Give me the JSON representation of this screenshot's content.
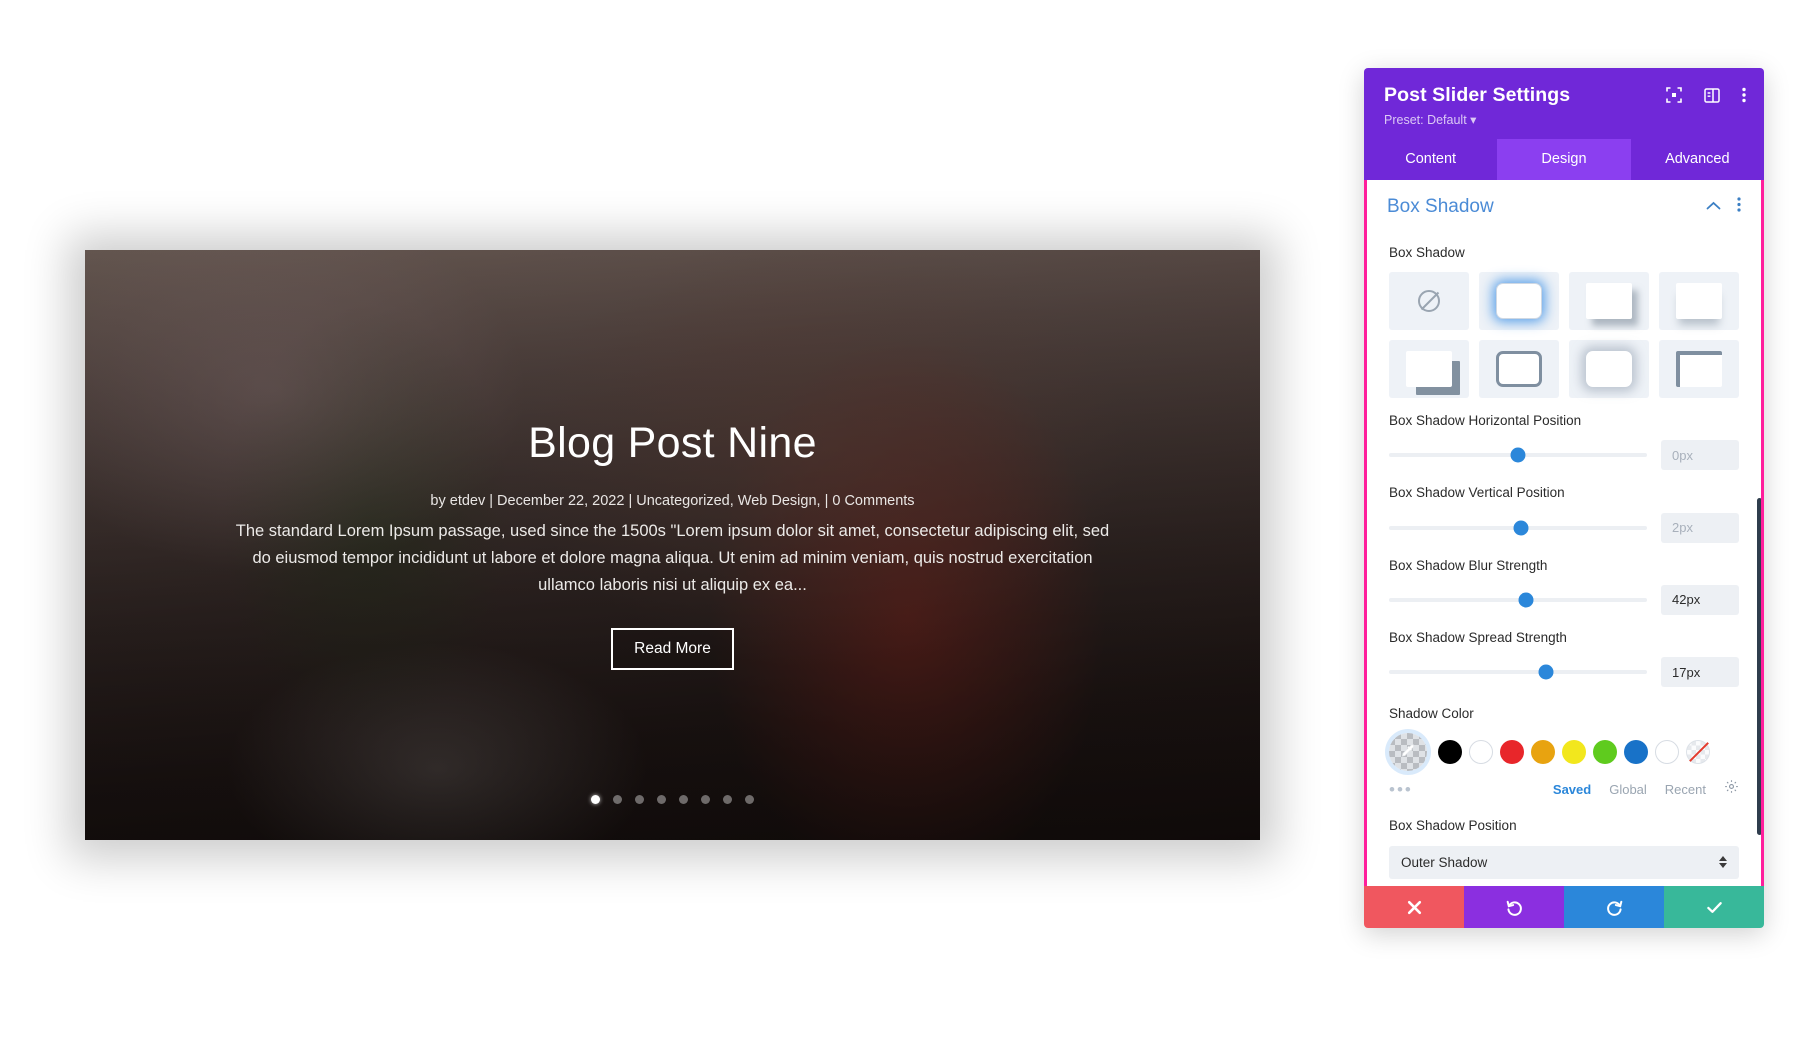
{
  "preview": {
    "post_title": "Blog Post Nine",
    "post_meta": "by etdev  |  December 22, 2022  |  Uncategorized, Web Design,  |  0 Comments",
    "post_excerpt": "The standard Lorem Ipsum passage, used since the 1500s \"Lorem ipsum dolor sit amet, consectetur adipiscing elit, sed do eiusmod tempor incididunt ut labore et dolore magna aliqua. Ut enim ad minim veniam, quis nostrud exercitation ullamco laboris nisi ut aliquip ex ea...",
    "read_more_label": "Read More",
    "dot_count": 8,
    "active_dot_index": 0
  },
  "panel": {
    "title": "Post Slider Settings",
    "preset": "Preset: Default",
    "header_icons": [
      "focus-target-icon",
      "layout-panel-icon",
      "kebab-menu-icon"
    ],
    "tabs": [
      {
        "label": "Content",
        "active": false
      },
      {
        "label": "Design",
        "active": true
      },
      {
        "label": "Advanced",
        "active": false
      }
    ],
    "section": {
      "title": "Box Shadow",
      "collapse_icon": "chevron-up-icon",
      "options_icon": "kebab-menu-icon"
    },
    "box_shadow": {
      "label": "Box Shadow",
      "presets": [
        {
          "name": "none",
          "selected": false
        },
        {
          "name": "glow",
          "selected": true
        },
        {
          "name": "offset-soft",
          "selected": false
        },
        {
          "name": "bottom-soft",
          "selected": false
        },
        {
          "name": "hard-offset",
          "selected": false
        },
        {
          "name": "outline",
          "selected": false
        },
        {
          "name": "blur-all",
          "selected": false
        },
        {
          "name": "corner-top-left",
          "selected": false
        }
      ]
    },
    "fields": [
      {
        "label": "Box Shadow Horizontal Position",
        "value": "0px",
        "is_placeholder": true,
        "knob_pct": 50
      },
      {
        "label": "Box Shadow Vertical Position",
        "value": "2px",
        "is_placeholder": true,
        "knob_pct": 51
      },
      {
        "label": "Box Shadow Blur Strength",
        "value": "42px",
        "is_placeholder": false,
        "knob_pct": 53
      },
      {
        "label": "Box Shadow Spread Strength",
        "value": "17px",
        "is_placeholder": false,
        "knob_pct": 61
      }
    ],
    "shadow_color": {
      "label": "Shadow Color",
      "picker_icon": "eyedropper-icon",
      "picker_selected": true,
      "swatches": [
        {
          "name": "black",
          "hex": "#000000"
        },
        {
          "name": "white",
          "hex": "#ffffff"
        },
        {
          "name": "red",
          "hex": "#e8262a"
        },
        {
          "name": "orange",
          "hex": "#e8a310"
        },
        {
          "name": "yellow",
          "hex": "#f2e71d"
        },
        {
          "name": "green",
          "hex": "#5fcb1e"
        },
        {
          "name": "blue",
          "hex": "#1872c8"
        },
        {
          "name": "white2",
          "hex": "#ffffff"
        }
      ],
      "no_color_name": "transparent",
      "more_label": "•••",
      "links": [
        {
          "label": "Saved",
          "active": true
        },
        {
          "label": "Global",
          "active": false
        },
        {
          "label": "Recent",
          "active": false
        }
      ],
      "settings_icon": "gear-icon"
    },
    "position_field": {
      "label": "Box Shadow Position",
      "value": "Outer Shadow"
    },
    "footer": {
      "cancel": "close-icon",
      "undo": "undo-icon",
      "redo": "redo-icon",
      "save": "check-icon"
    },
    "accent_border_color": "#ff1f9c"
  }
}
